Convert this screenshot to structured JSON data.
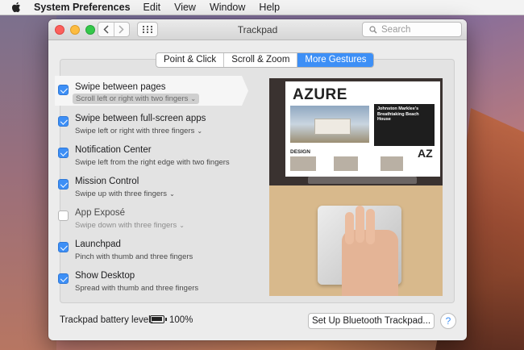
{
  "menubar": {
    "app_name": "System Preferences",
    "items": [
      "Edit",
      "View",
      "Window",
      "Help"
    ]
  },
  "window": {
    "title": "Trackpad",
    "search_placeholder": "Search"
  },
  "tabs": [
    {
      "label": "Point & Click",
      "active": false
    },
    {
      "label": "Scroll & Zoom",
      "active": false
    },
    {
      "label": "More Gestures",
      "active": true
    }
  ],
  "options": [
    {
      "title": "Swipe between pages",
      "subtitle": "Scroll left or right with two fingers",
      "checked": true,
      "has_menu": true,
      "selected": true
    },
    {
      "title": "Swipe between full-screen apps",
      "subtitle": "Swipe left or right with three fingers",
      "checked": true,
      "has_menu": true
    },
    {
      "title": "Notification Center",
      "subtitle": "Swipe left from the right edge with two fingers",
      "checked": true,
      "has_menu": false
    },
    {
      "title": "Mission Control",
      "subtitle": "Swipe up with three fingers",
      "checked": true,
      "has_menu": true
    },
    {
      "title": "App Exposé",
      "subtitle": "Swipe down with three fingers",
      "checked": false,
      "has_menu": true
    },
    {
      "title": "Launchpad",
      "subtitle": "Pinch with thumb and three fingers",
      "checked": true,
      "has_menu": false
    },
    {
      "title": "Show Desktop",
      "subtitle": "Spread with thumb and three fingers",
      "checked": true,
      "has_menu": false
    }
  ],
  "preview": {
    "site_title": "AZURE",
    "headline": "Johnston Marklee's Breathtaking Beach House",
    "section": "DESIGN",
    "badge": "AZ"
  },
  "battery": {
    "label": "Trackpad battery level:",
    "percent_text": "100%",
    "level": 1.0
  },
  "buttons": {
    "bluetooth": "Set Up Bluetooth Trackpad...",
    "help": "?"
  },
  "colors": {
    "accent": "#3d8ff6"
  }
}
